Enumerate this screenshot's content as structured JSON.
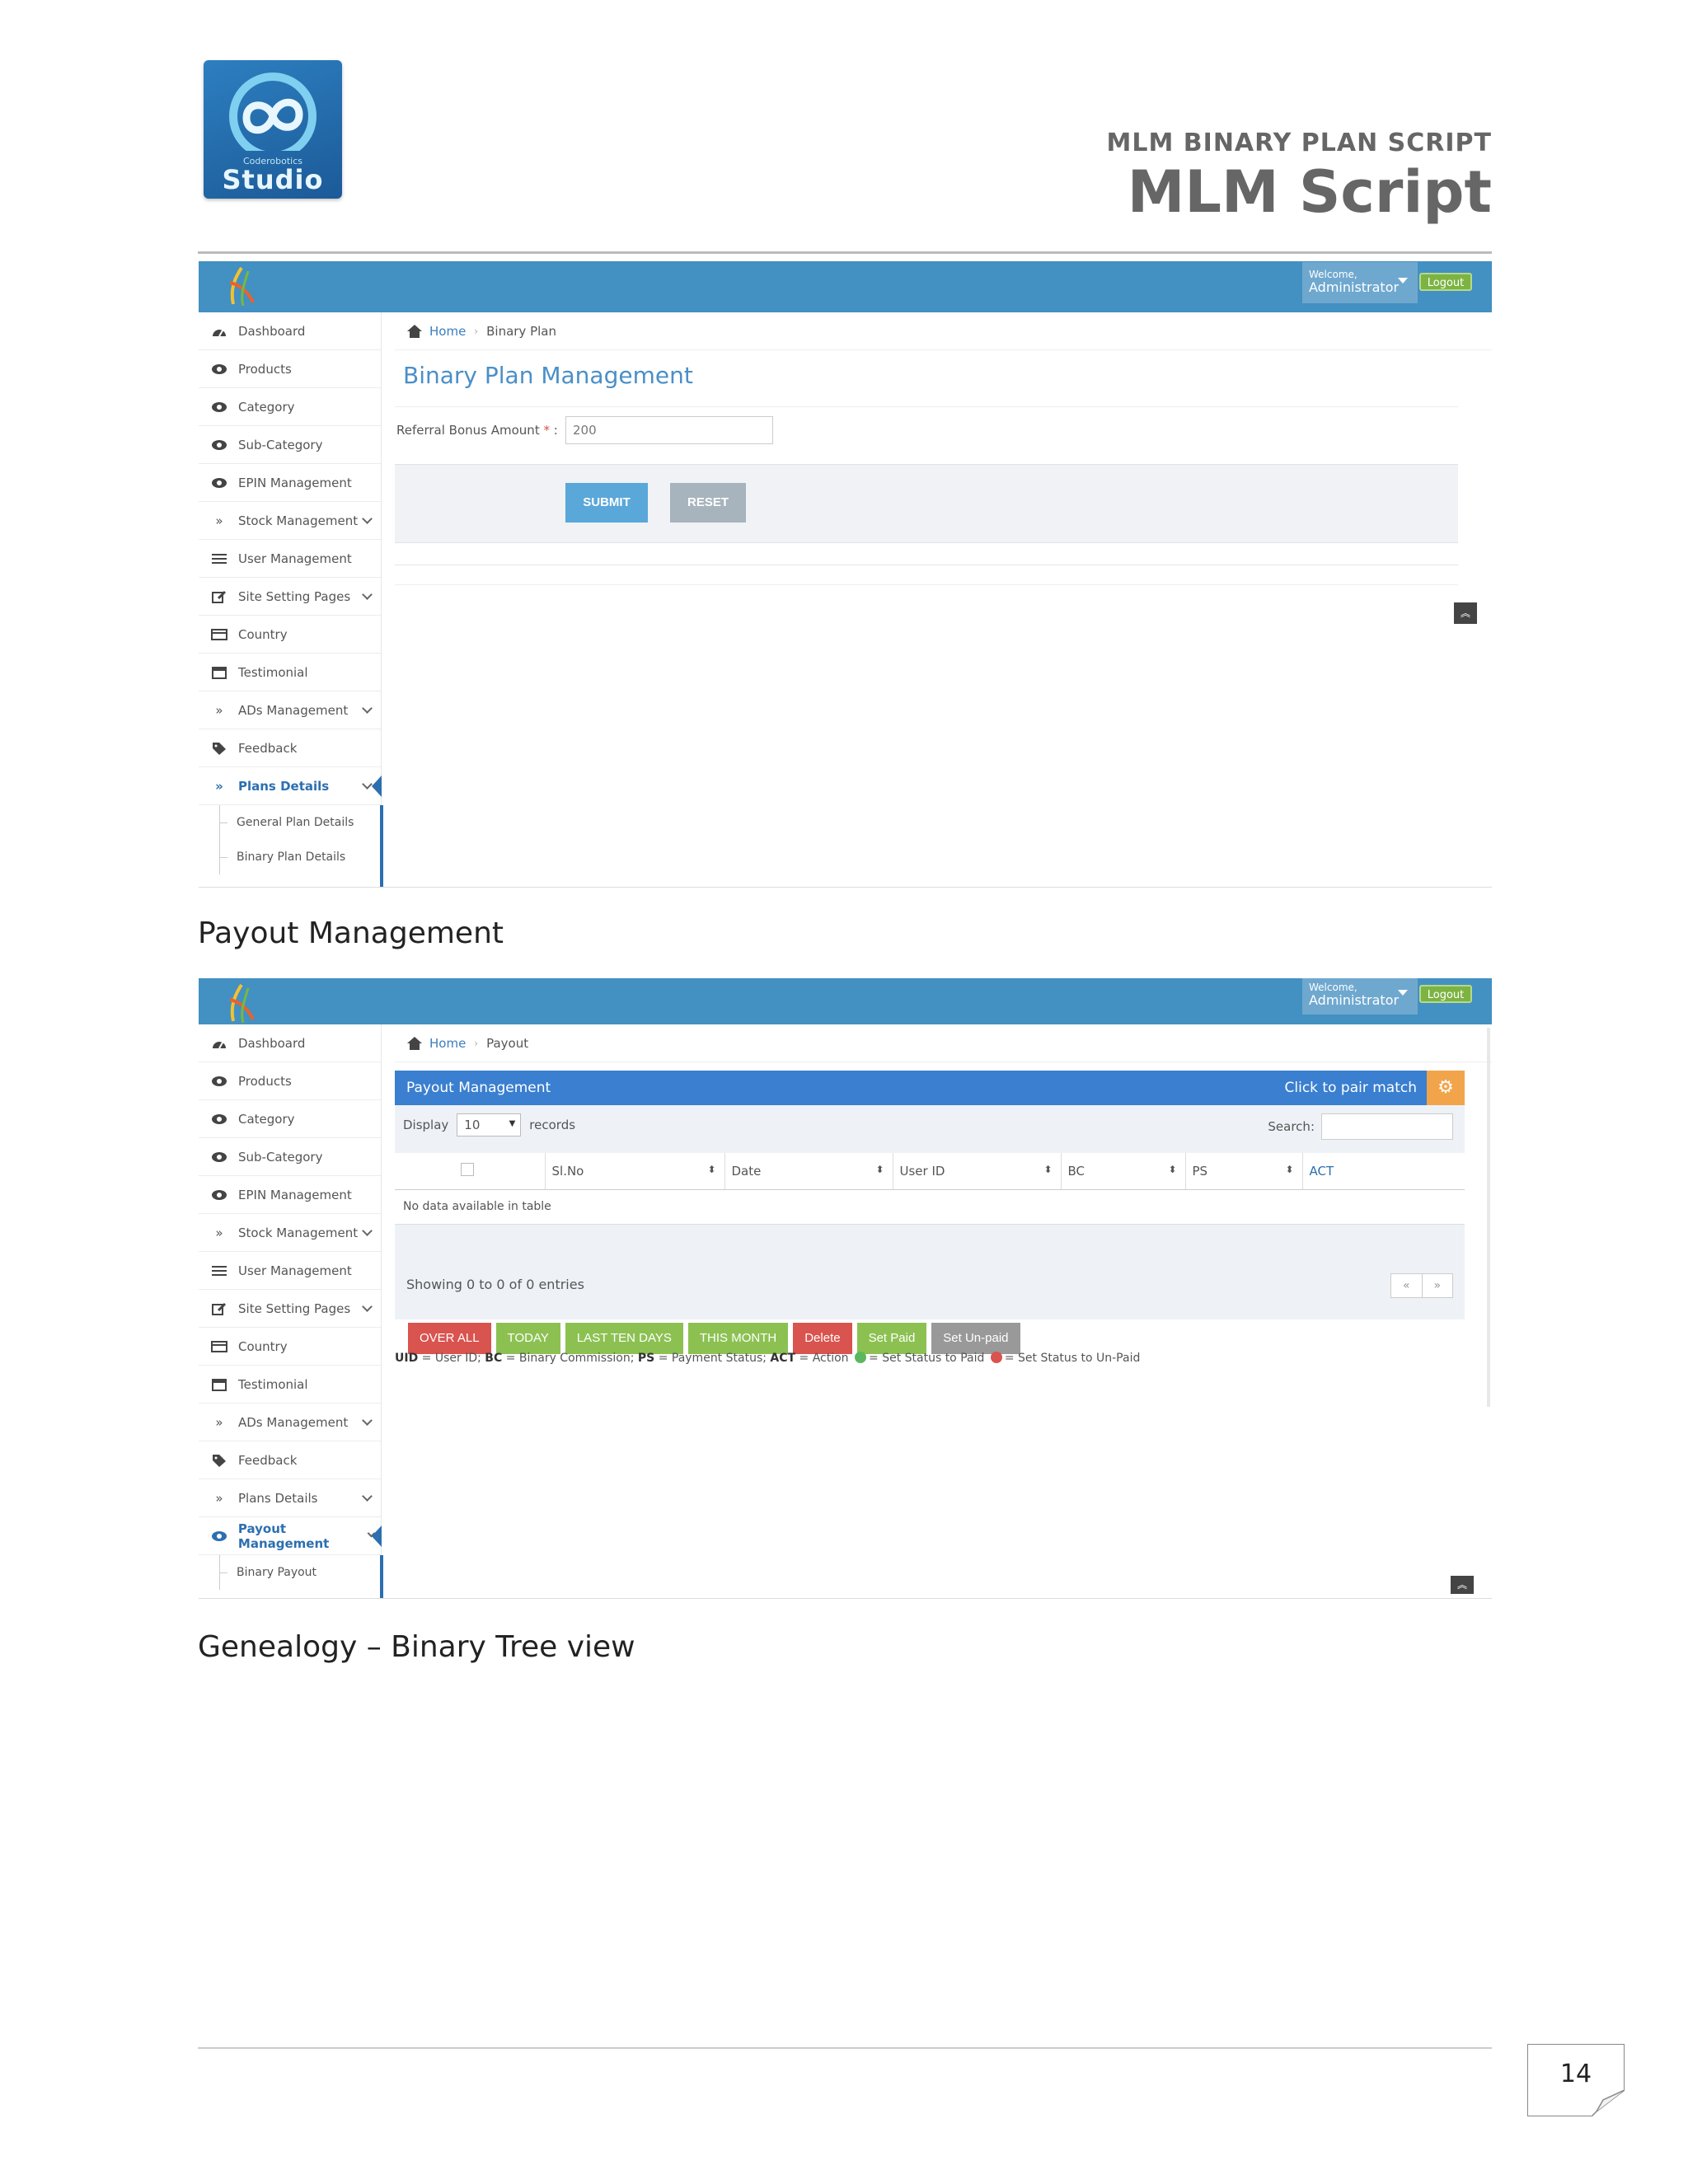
{
  "logo": {
    "small": "Coderobotics",
    "main": "Studio"
  },
  "header": {
    "subtitle": "MLM BINARY PLAN SCRIPT",
    "title": "MLM Script"
  },
  "admin": {
    "welcome": "Welcome,",
    "user": "Administrator",
    "logout": "Logout"
  },
  "sidebar1": {
    "items": [
      {
        "label": "Dashboard",
        "icon": "dashboard-icon"
      },
      {
        "label": "Products",
        "icon": "eye-icon"
      },
      {
        "label": "Category",
        "icon": "eye-icon"
      },
      {
        "label": "Sub-Category",
        "icon": "eye-icon"
      },
      {
        "label": "EPIN Management",
        "icon": "eye-icon"
      },
      {
        "label": "Stock Management",
        "icon": "double-chevron-icon"
      },
      {
        "label": "User Management",
        "icon": "list-icon"
      },
      {
        "label": "Site Setting Pages",
        "icon": "edit-icon"
      },
      {
        "label": "Country",
        "icon": "card-icon"
      },
      {
        "label": "Testimonial",
        "icon": "calendar-icon"
      },
      {
        "label": "ADs Management",
        "icon": "double-chevron-icon"
      },
      {
        "label": "Feedback",
        "icon": "tag-icon"
      },
      {
        "label": "Plans Details",
        "icon": "double-chevron-icon"
      }
    ],
    "subitems": [
      "General Plan Details",
      "Binary Plan Details"
    ]
  },
  "sidebar2": {
    "items": [
      {
        "label": "Dashboard"
      },
      {
        "label": "Products"
      },
      {
        "label": "Category"
      },
      {
        "label": "Sub-Category"
      },
      {
        "label": "EPIN Management"
      },
      {
        "label": "Stock Management"
      },
      {
        "label": "User Management"
      },
      {
        "label": "Site Setting Pages"
      },
      {
        "label": "Country"
      },
      {
        "label": "Testimonial"
      },
      {
        "label": "ADs Management"
      },
      {
        "label": "Feedback"
      },
      {
        "label": "Plans Details"
      },
      {
        "label": "Payout Management"
      }
    ],
    "subitems": [
      "Binary Payout"
    ]
  },
  "binary": {
    "crumb_home": "Home",
    "crumb_current": "Binary Plan",
    "title": "Binary Plan Management",
    "field_label": "Referral Bonus Amount",
    "required_mark": "*",
    "field_colon": ":",
    "field_value": "200",
    "submit": "SUBMIT",
    "reset": "RESET"
  },
  "section_payout": "Payout Management",
  "payout": {
    "crumb_home": "Home",
    "crumb_current": "Payout",
    "panel_title": "Payout Management",
    "click_pair": "Click to pair match",
    "display_label": "Display",
    "display_value": "10",
    "records_label": "records",
    "search_label": "Search:",
    "columns": [
      "Sl.No",
      "Date",
      "User ID",
      "BC",
      "PS",
      "ACT"
    ],
    "empty": "No data available in table",
    "showing": "Showing 0 to 0 of 0 entries",
    "buttons": [
      {
        "label": "OVER ALL",
        "color": "#d9534f"
      },
      {
        "label": "TODAY",
        "color": "#8cc152"
      },
      {
        "label": "LAST TEN DAYS",
        "color": "#8cc152"
      },
      {
        "label": "THIS MONTH",
        "color": "#8cc152"
      },
      {
        "label": "Delete",
        "color": "#d9534f"
      },
      {
        "label": "Set Paid",
        "color": "#8cc152"
      },
      {
        "label": "Set Un-paid",
        "color": "#999999"
      }
    ],
    "legend": {
      "uid": "UID",
      "uid_text": "= User ID;",
      "bc": "BC",
      "bc_text": "= Binary Commission;",
      "ps": "PS",
      "ps_text": "= Payment Status;",
      "act": "ACT",
      "act_text": "= Action",
      "paid_text": "= Set Status to Paid",
      "unpaid_text": "= Set Status to Un-Paid"
    }
  },
  "section_genealogy": "Genealogy – Binary Tree view",
  "page_number": "14"
}
